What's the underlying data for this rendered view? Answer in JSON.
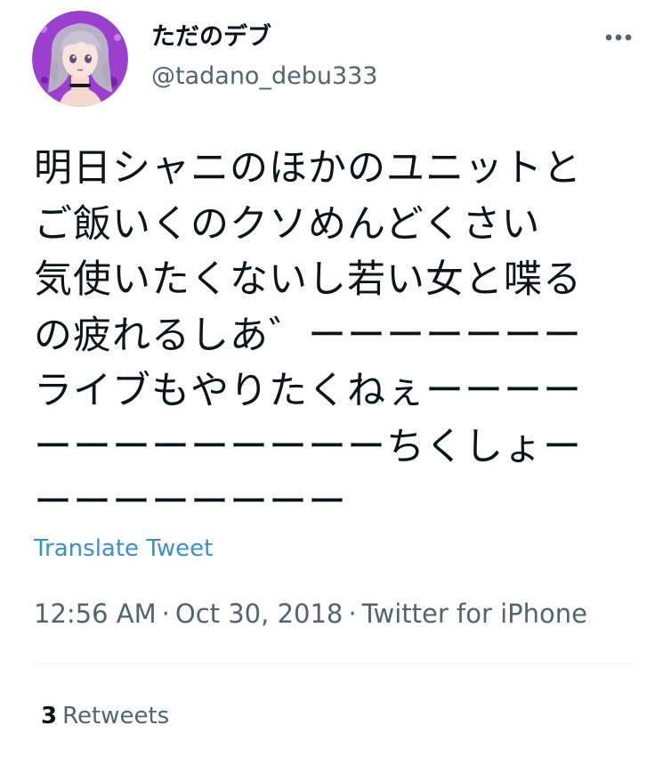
{
  "user": {
    "display_name": "ただのデブ",
    "handle": "@tadano_debu333",
    "avatar_icon": "user-avatar-illustration"
  },
  "more_icon": "ellipsis-icon",
  "tweet": {
    "lines": [
      "明日シャニのほかのユニットと",
      "ご飯いくのクソめんどくさい",
      "気使いたくないし若い女と喋る",
      "の疲れるしあ゛ーーーーーーー",
      "ライブもやりたくねぇーーーー",
      "ーーーーーーーーーちくしょー",
      "ーーーーーーーー"
    ]
  },
  "translate_label": "Translate Tweet",
  "meta": {
    "time": "12:56 AM",
    "date": "Oct 30, 2018",
    "source": "Twitter for iPhone",
    "separator": "·"
  },
  "stats": {
    "retweets_count": "3",
    "retweets_label": "Retweets"
  },
  "colors": {
    "text": "#0f1419",
    "secondary": "#536471",
    "link": "#3a8fd0",
    "avatar_bg": "#9b3fcf"
  }
}
